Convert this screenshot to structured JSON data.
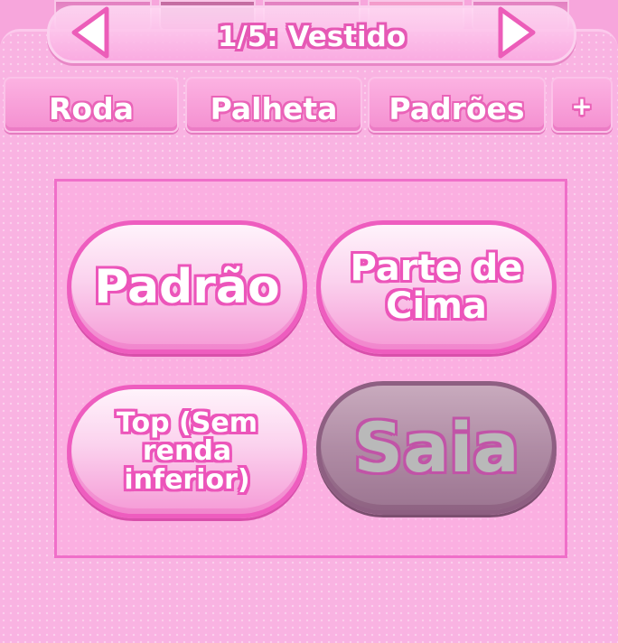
{
  "header": {
    "title": "1/5: Vestido",
    "prev_icon": "triangle-left-icon",
    "next_icon": "triangle-right-icon"
  },
  "tabs": [
    {
      "label": "Roda"
    },
    {
      "label": "Palheta"
    },
    {
      "label": "Padrões"
    },
    {
      "label": "+"
    }
  ],
  "options": [
    {
      "label": "Padrão",
      "selected": false
    },
    {
      "label": "Parte de Cima",
      "selected": false
    },
    {
      "label": "Top (Sem renda inferior)",
      "selected": false
    },
    {
      "label": "Saia",
      "selected": true
    }
  ],
  "colors": {
    "accent": "#ee5dbf",
    "panel": "#f9b3e2",
    "selected_button": "#b08ca5"
  }
}
